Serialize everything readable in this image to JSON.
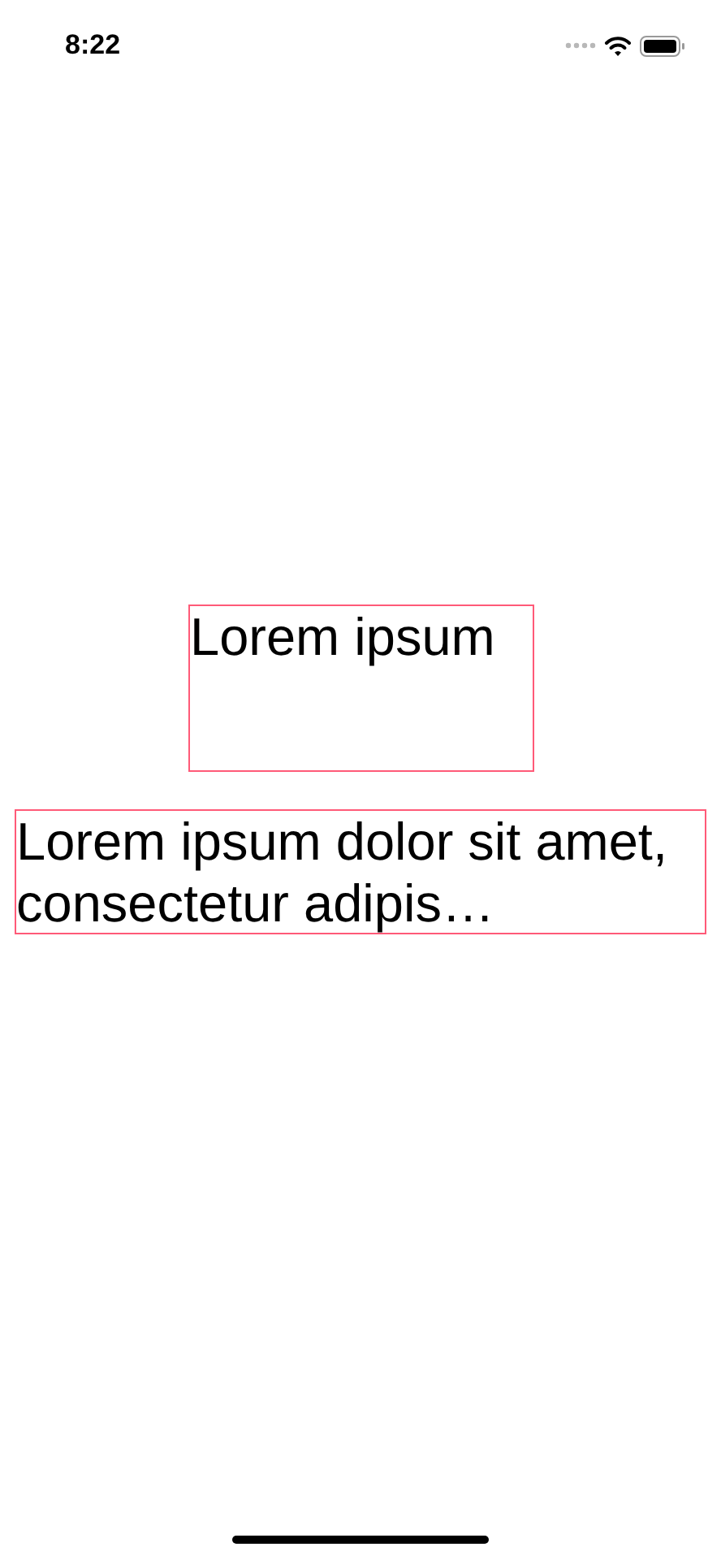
{
  "status_bar": {
    "time": "8:22"
  },
  "labels": [
    {
      "text": "Lorem ipsum",
      "kind": "short"
    },
    {
      "text": "Lorem ipsum dolor sit amet, consectetur adipis…",
      "kind": "wide"
    }
  ]
}
